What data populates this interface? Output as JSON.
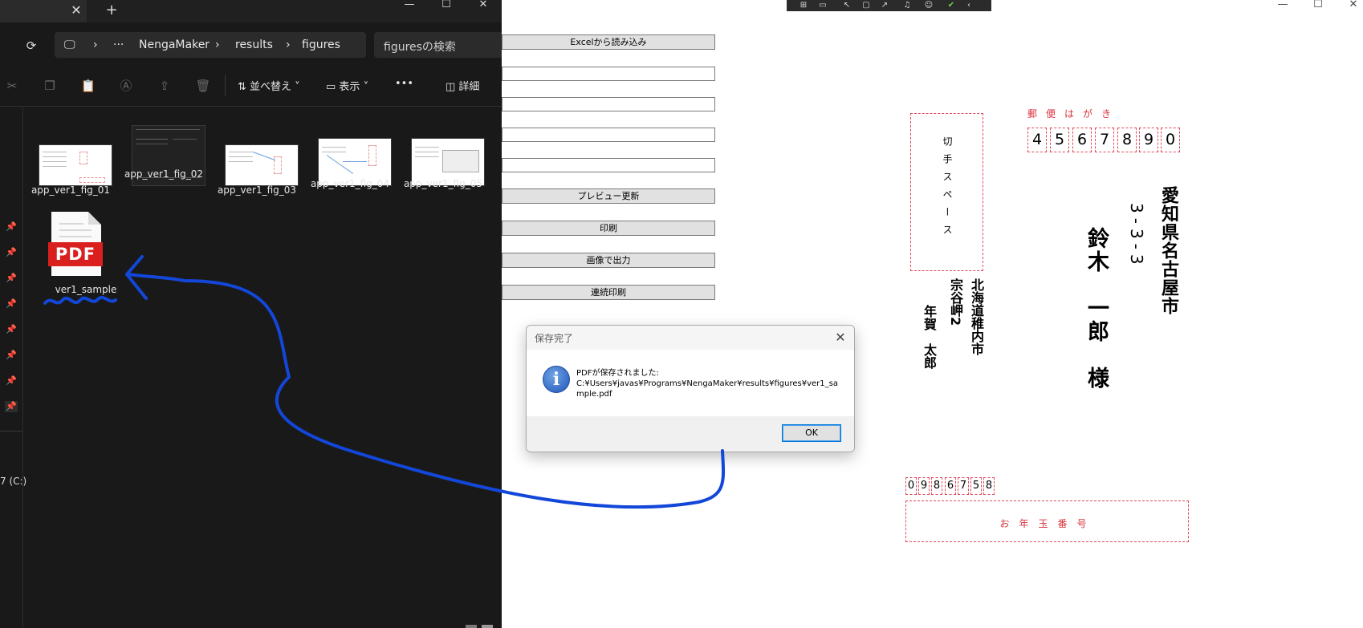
{
  "explorer": {
    "path": [
      "NengaMaker",
      "results",
      "figures"
    ],
    "path_more": "···",
    "search_placeholder": "figuresの検索",
    "commands": {
      "sort": "並べ替え",
      "view": "表示",
      "more": "•••",
      "details": "詳細"
    },
    "drive_label": "7 (C:)",
    "files": [
      {
        "name": "app_ver1_fig_01"
      },
      {
        "name": "app_ver1_fig_02"
      },
      {
        "name": "app_ver1_fig_03"
      },
      {
        "name": "app_ver1_fig_04"
      },
      {
        "name": "app_ver1_fig_05"
      }
    ],
    "pdf_file": {
      "badge": "PDF",
      "name": "ver1_sample"
    }
  },
  "app": {
    "buttons": {
      "excel": "Excelから読み込み",
      "preview": "プレビュー更新",
      "print": "印刷",
      "image": "画像で出力",
      "batch": "連続印刷"
    },
    "postcard": {
      "stamp_label": "切手スペース",
      "postal_title": "郵便はがき",
      "zip": [
        "4",
        "5",
        "6",
        "7",
        "8",
        "9",
        "0"
      ],
      "recipient_address": "愛知県名古屋市",
      "recipient_number": "3-3-3",
      "recipient_name": "鈴木　一郎　様",
      "sender_address": "北海道稚内市",
      "sender_area": "宗谷岬2",
      "sender_name": "年賀　太郎",
      "sender_zip": [
        "0",
        "9",
        "8",
        "6",
        "7",
        "5",
        "8"
      ],
      "lottery_label": "お年玉番号"
    }
  },
  "dialog": {
    "title": "保存完了",
    "message_line1": "PDFが保存されました:",
    "message_path": "C:¥Users¥javas¥Programs¥NengaMaker¥results¥figures¥ver1_sample.pdf",
    "ok": "OK"
  },
  "colors": {
    "annotation": "#1347d9",
    "postcard_red": "#d9323c"
  }
}
